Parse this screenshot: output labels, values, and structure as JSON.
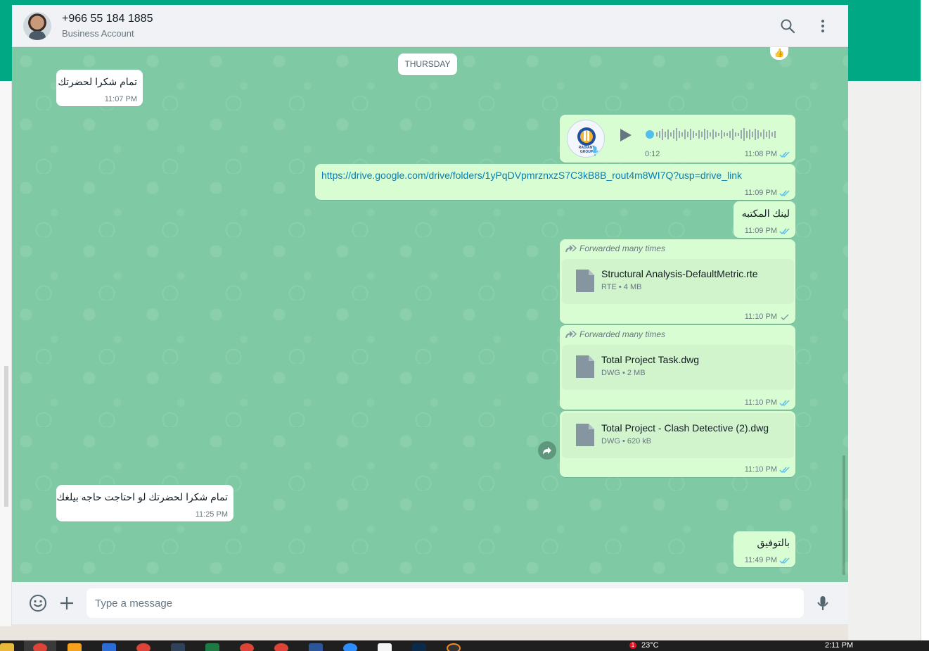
{
  "header": {
    "contact_name": "+966 55 184 1885",
    "contact_subtitle": "Business Account",
    "icons": [
      "search-icon",
      "menu-icon"
    ]
  },
  "chat": {
    "day_label": "THURSDAY",
    "reaction": "👍",
    "messages": [
      {
        "dir": "in",
        "type": "text",
        "text": "تمام شكرا لحضرتك",
        "time": "11:07 PM"
      },
      {
        "dir": "out",
        "type": "voice",
        "duration": "0:12",
        "time": "11:08 PM",
        "status": "read",
        "avatar_label": "RADIANT GROUP"
      },
      {
        "dir": "out",
        "type": "link",
        "text": "https://drive.google.com/drive/folders/1yPqDVpmrznxzS7C3kB8B_rout4m8WI7Q?usp=drive_link",
        "time": "11:09 PM",
        "status": "read"
      },
      {
        "dir": "out",
        "type": "text",
        "text": "لينك المكتبه",
        "time": "11:09 PM",
        "status": "read"
      },
      {
        "dir": "out",
        "type": "document",
        "forwarded": "Forwarded many times",
        "file_name": "Structural Analysis-DefaultMetric.rte",
        "file_type": "RTE",
        "file_size": "4 MB",
        "time": "11:10 PM",
        "status": "sent"
      },
      {
        "dir": "out",
        "type": "document",
        "forwarded": "Forwarded many times",
        "file_name": "Total Project Task.dwg",
        "file_type": "DWG",
        "file_size": "2 MB",
        "time": "11:10 PM",
        "status": "read"
      },
      {
        "dir": "out",
        "type": "document",
        "file_name": "Total Project - Clash Detective (2).dwg",
        "file_type": "DWG",
        "file_size": "620 kB",
        "time": "11:10 PM",
        "status": "read"
      },
      {
        "dir": "in",
        "type": "text",
        "text": "تمام شكرا لحضرتك لو احتاجت حاجه بيلغك",
        "time": "11:25 PM"
      },
      {
        "dir": "out",
        "type": "text",
        "text": "بالتوفيق",
        "time": "11:49 PM",
        "status": "read"
      }
    ]
  },
  "composer": {
    "placeholder": "Type a message",
    "icons": [
      "emoji-icon",
      "attach-plus-icon",
      "microphone-icon"
    ]
  },
  "taskbar": {
    "temperature": "23°C",
    "clock": "2:11 PM",
    "notification_count": "1"
  },
  "colors": {
    "brand_green": "#00a884",
    "chat_wallpaper": "#7fcaa4",
    "outgoing_bubble": "#d9fdd3",
    "incoming_bubble": "#ffffff",
    "read_tick": "#53bdeb",
    "link": "#027eb5"
  }
}
